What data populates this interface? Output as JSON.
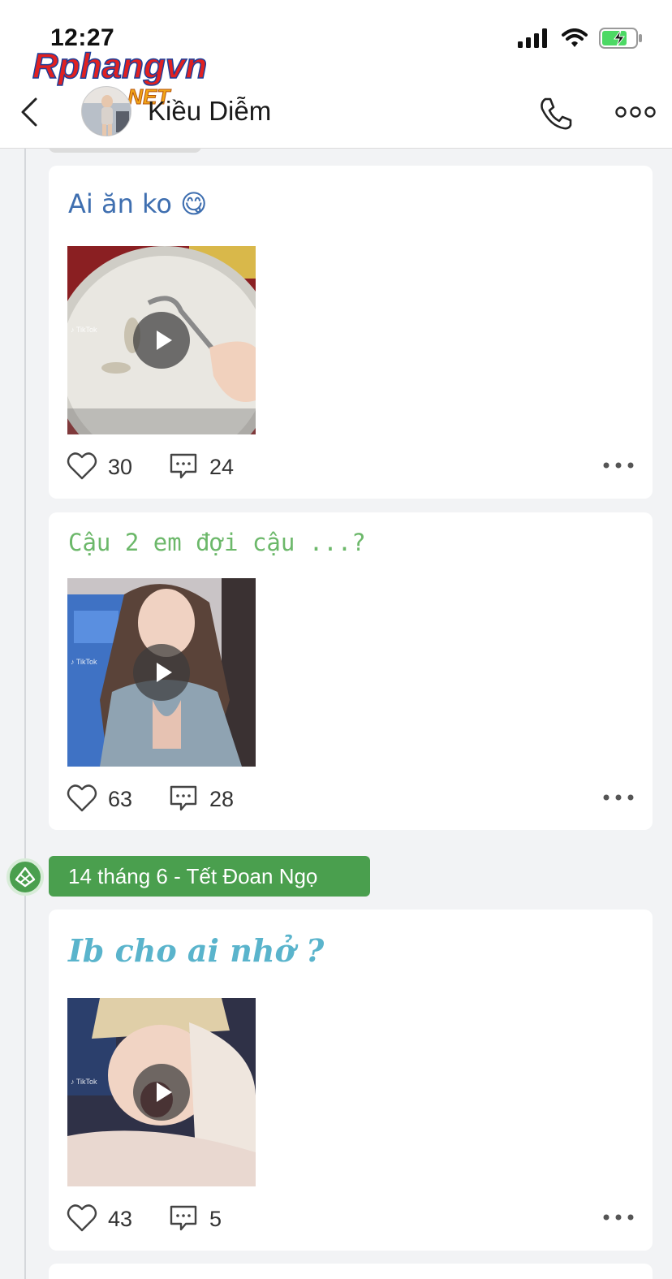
{
  "status_bar": {
    "time": "12:27"
  },
  "watermark": {
    "brand": "Rphangvn",
    "suffix": ".NET"
  },
  "header": {
    "contact_name": "Kiều Diễm",
    "icons": [
      "chevron-left-icon",
      "phone-icon",
      "more-horizontal-icon"
    ]
  },
  "posts": [
    {
      "title": "Ai ăn ko 😋",
      "likes": "30",
      "comments": "24",
      "title_color": "#3f6fb0"
    },
    {
      "title": "Cậu 2 em đợi cậu ...?",
      "likes": "63",
      "comments": "28",
      "title_color": "#6cb86a"
    },
    {
      "title": "Ib cho ai nhở ?",
      "likes": "43",
      "comments": "5",
      "title_color": "#5ab4cc"
    }
  ],
  "date_label": "14 tháng 6 - Tết Đoan Ngọ",
  "colors": {
    "accent_green": "#4a9f4e",
    "background": "#f2f3f5",
    "battery_green": "#4cd964"
  }
}
